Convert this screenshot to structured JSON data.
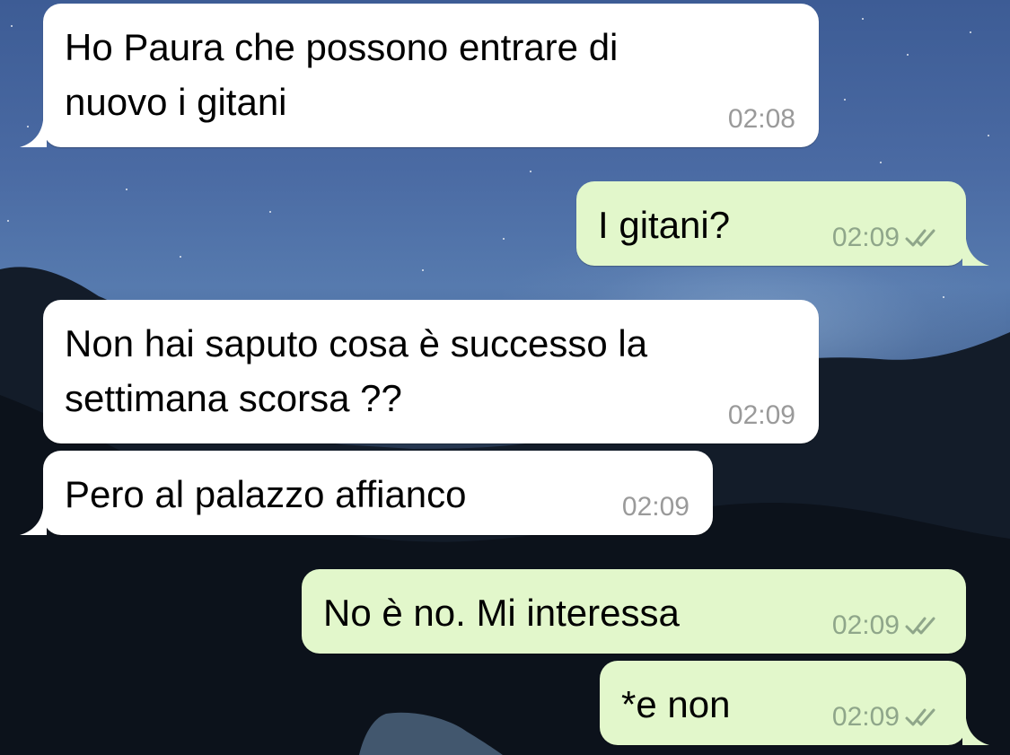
{
  "messages": [
    {
      "direction": "incoming",
      "text": "Ho Paura che possono entrare di\nnuovo i gitani",
      "time": "02:08"
    },
    {
      "direction": "outgoing",
      "text": "I gitani?",
      "time": "02:09",
      "status": "read-double-check-icon"
    },
    {
      "direction": "incoming",
      "text": "Non hai saputo cosa è successo la\nsettimana scorsa ??",
      "time": "02:09"
    },
    {
      "direction": "incoming",
      "text": "Pero al palazzo affianco",
      "time": "02:09"
    },
    {
      "direction": "outgoing",
      "text": "No è no. Mi interessa",
      "time": "02:09",
      "status": "read-double-check-icon"
    },
    {
      "direction": "outgoing",
      "text": "*e non",
      "time": "02:09",
      "status": "read-double-check-icon"
    }
  ],
  "colors": {
    "incoming_bubble": "#ffffff",
    "outgoing_bubble": "#e2f7cb",
    "timestamp": "#9a9a9a",
    "outgoing_timestamp": "#8fa68a"
  }
}
